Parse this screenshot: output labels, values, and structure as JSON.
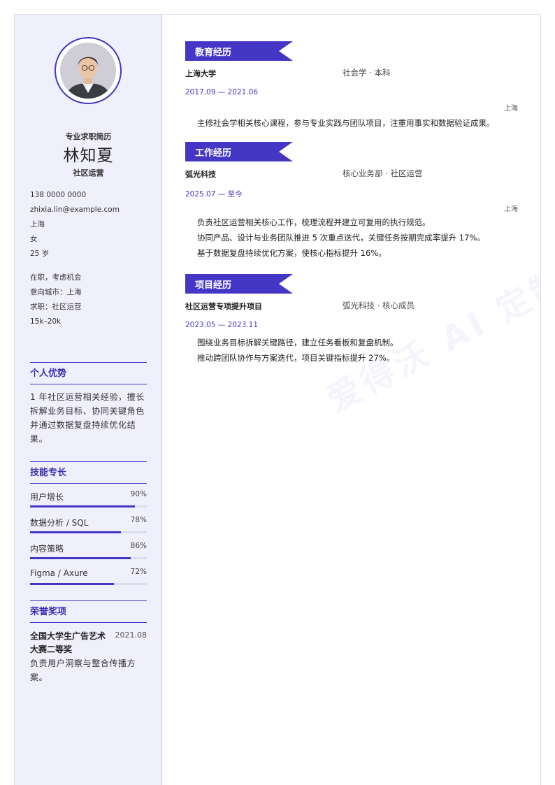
{
  "profile": {
    "tagline": "专业求职简历",
    "name": "林知夏",
    "role": "社区运营"
  },
  "contact": [
    "138 0000 0000",
    "zhixia.lin@example.com",
    "上海",
    "女",
    "25 岁"
  ],
  "intent": [
    "在职，考虑机会",
    "意向城市：上海",
    "求职：社区运营",
    "15k–20k"
  ],
  "advantage": {
    "title": "个人优势",
    "text": "1 年社区运营相关经验，擅长拆解业务目标、协同关键角色并通过数据复盘持续优化结果。"
  },
  "skills": {
    "title": "技能专长",
    "items": [
      {
        "name": "用户增长",
        "percent": "90%",
        "value": 0.9
      },
      {
        "name": "数据分析 / SQL",
        "percent": "78%",
        "value": 0.78
      },
      {
        "name": "内容策略",
        "percent": "86%",
        "value": 0.86
      },
      {
        "name": "Figma / Axure",
        "percent": "72%",
        "value": 0.72
      }
    ]
  },
  "awards": {
    "title": "荣誉奖项",
    "items": [
      {
        "name": "全国大学生广告艺术大赛二等奖",
        "date": "2021.08",
        "desc": "负责用户洞察与整合传播方案。"
      }
    ]
  },
  "education": {
    "title": "教育经历",
    "org": "上海大学",
    "sub": "社会学 · 本科",
    "date": "2017.09 — 2021.06",
    "location": "上海",
    "lines": [
      "主修社会学相关核心课程，参与专业实践与团队项目，注重用事实和数据验证成果。"
    ]
  },
  "work": {
    "title": "工作经历",
    "org": "弧光科技",
    "sub": "核心业务部 · 社区运营",
    "date": "2025.07 — 至今",
    "location": "上海",
    "lines": [
      "负责社区运营相关核心工作，梳理流程并建立可复用的执行规范。",
      "协同产品、设计与业务团队推进 5 次重点迭代，关键任务按期完成率提升 17%。",
      "基于数据复盘持续优化方案，使核心指标提升 16%。"
    ]
  },
  "project": {
    "title": "项目经历",
    "org": "社区运营专项提升项目",
    "sub": "弧光科技 · 核心成员",
    "date": "2023.05 — 2023.11",
    "lines": [
      "围绕业务目标拆解关键路径，建立任务看板和复盘机制。",
      "推动跨团队协作与方案迭代，项目关键指标提升 27%。"
    ]
  },
  "watermark": "爱得沃 AI 定制简历",
  "colors": {
    "accent": "#4437c6",
    "sidebar_bg": "#f0effc",
    "track": "#dedcef"
  }
}
